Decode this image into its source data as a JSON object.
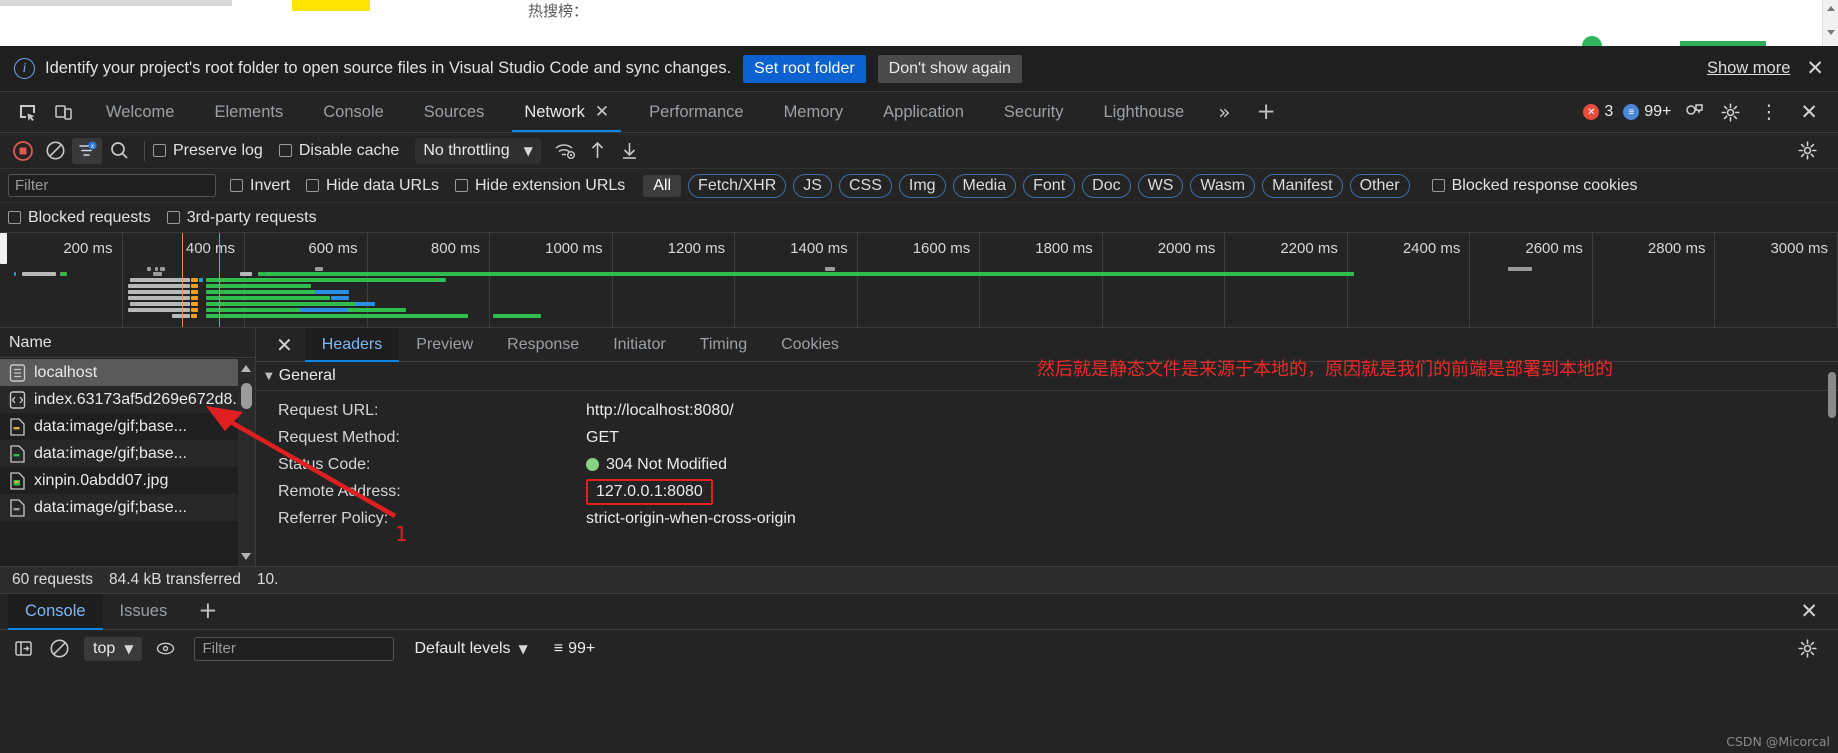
{
  "page": {
    "hot_label": "热搜榜："
  },
  "banner": {
    "icon": "info-icon",
    "message": "Identify your project's root folder to open source files in Visual Studio Code and sync changes.",
    "primary_button": "Set root folder",
    "secondary_button": "Don't show again",
    "show_more": "Show more",
    "close": "✕"
  },
  "tabbar": {
    "tabs": [
      {
        "label": "Welcome",
        "active": false,
        "closable": false
      },
      {
        "label": "Elements",
        "active": false,
        "closable": false
      },
      {
        "label": "Console",
        "active": false,
        "closable": false
      },
      {
        "label": "Sources",
        "active": false,
        "closable": false
      },
      {
        "label": "Network",
        "active": true,
        "closable": true
      },
      {
        "label": "Performance",
        "active": false,
        "closable": false
      },
      {
        "label": "Memory",
        "active": false,
        "closable": false
      },
      {
        "label": "Application",
        "active": false,
        "closable": false
      },
      {
        "label": "Security",
        "active": false,
        "closable": false
      },
      {
        "label": "Lighthouse",
        "active": false,
        "closable": false
      }
    ],
    "more": "»",
    "plus": "+",
    "error_count": "3",
    "message_count": "99+",
    "tab_close_glyph": "✕"
  },
  "network_toolbar": {
    "record_icon": "record-stop-icon",
    "clear_icon": "clear-icon",
    "filter_icon": "filter-icon",
    "search_icon": "search-icon",
    "preserve_log": "Preserve log",
    "disable_cache": "Disable cache",
    "throttling": "No throttling",
    "throttle_caret": "▼",
    "wifi_icon": "network-conditions-icon",
    "upload_icon": "import-har-icon",
    "download_icon": "export-har-icon",
    "settings_icon": "gear-icon"
  },
  "filter_row": {
    "filter_placeholder": "Filter",
    "invert": "Invert",
    "hide_data_urls": "Hide data URLs",
    "hide_extension_urls": "Hide extension URLs",
    "types": [
      "All",
      "Fetch/XHR",
      "JS",
      "CSS",
      "Img",
      "Media",
      "Font",
      "Doc",
      "WS",
      "Wasm",
      "Manifest",
      "Other"
    ],
    "active_type": "All",
    "blocked_response_cookies": "Blocked response cookies",
    "blocked_requests": "Blocked requests",
    "third_party_requests": "3rd-party requests"
  },
  "overview": {
    "ticks": [
      "200 ms",
      "400 ms",
      "600 ms",
      "800 ms",
      "1000 ms",
      "1200 ms",
      "1400 ms",
      "1600 ms",
      "1800 ms",
      "2000 ms",
      "2200 ms",
      "2400 ms",
      "2600 ms",
      "2800 ms",
      "3000 ms"
    ],
    "dcl_color": "#ef8b5c",
    "load_color": "#20c9c9"
  },
  "requests": {
    "column_header": "Name",
    "items": [
      {
        "name": "localhost",
        "icon": "document-icon",
        "selected": true
      },
      {
        "name": "index.63173af5d269e672d8...",
        "icon": "code-icon",
        "selected": false
      },
      {
        "name": "data:image/gif;base...",
        "icon": "image-icon-yellow",
        "selected": false
      },
      {
        "name": "data:image/gif;base...",
        "icon": "image-icon-green",
        "selected": false
      },
      {
        "name": "xinpin.0abdd07.jpg",
        "icon": "image-icon-photo",
        "selected": false
      },
      {
        "name": "data:image/gif;base...",
        "icon": "image-icon-grey",
        "selected": false
      }
    ]
  },
  "details": {
    "tabs": [
      "Headers",
      "Preview",
      "Response",
      "Initiator",
      "Timing",
      "Cookies"
    ],
    "active_tab": "Headers",
    "close": "✕",
    "section_title": "General",
    "section_caret": "▼",
    "rows": [
      {
        "key": "Request URL:",
        "value": "http://localhost:8080/",
        "highlight": false,
        "status_dot": false
      },
      {
        "key": "Request Method:",
        "value": "GET",
        "highlight": false,
        "status_dot": false
      },
      {
        "key": "Status Code:",
        "value": "304 Not Modified",
        "highlight": false,
        "status_dot": true
      },
      {
        "key": "Remote Address:",
        "value": "127.0.0.1:8080",
        "highlight": true,
        "status_dot": false
      },
      {
        "key": "Referrer Policy:",
        "value": "strict-origin-when-cross-origin",
        "highlight": false,
        "status_dot": false
      }
    ]
  },
  "annotation": {
    "chinese_note": "然后就是静态文件是来源于本地的，原因就是我们的前端是部署到本地的",
    "marker_number": "1",
    "highlight_color": "#e02020"
  },
  "status_bar": {
    "requests": "60 requests",
    "transferred": "84.4 kB transferred",
    "resources": "10."
  },
  "drawer": {
    "tabs": [
      "Console",
      "Issues"
    ],
    "active_tab": "Console",
    "plus": "+",
    "close": "✕",
    "sidebar_icon": "console-sidebar-icon",
    "clear_icon": "clear-console-icon",
    "context": "top",
    "context_caret": "▼",
    "eye_icon": "live-expression-icon",
    "filter_placeholder": "Filter",
    "levels": "Default levels",
    "levels_caret": "▼",
    "message_count": "99+",
    "settings_icon": "gear-icon"
  },
  "watermark": {
    "text": "CSDN @Micorcal"
  }
}
